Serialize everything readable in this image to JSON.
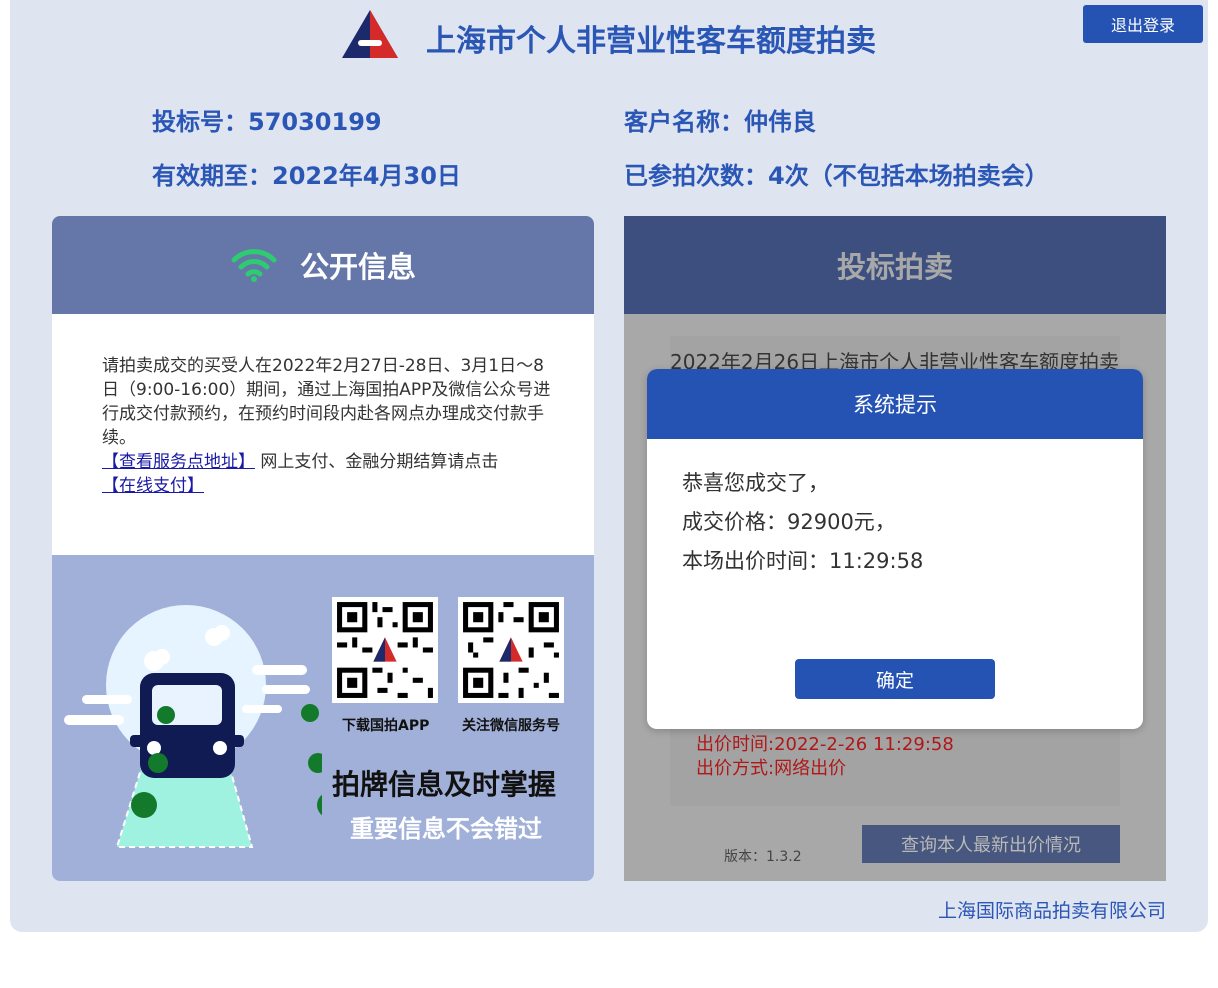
{
  "header": {
    "title": "上海市个人非营业性客车额度拍卖",
    "logout_label": "退出登录"
  },
  "bidder": {
    "bid_number": "投标号：57030199",
    "valid_until": "有效期至：2022年4月30日",
    "customer_name": "客户名称：仲伟良",
    "participation_count": "已参拍次数：4次（不包括本场拍卖会）"
  },
  "public_info": {
    "title": "公开信息",
    "notice": "请拍卖成交的买受人在2022年2月27日-28日、3月1日～8日（9:00-16:00）期间，通过上海国拍APP及微信公众号进行成交付款预约，在预约时间段内赴各网点办理成交付款手续。",
    "service_link": "【查看服务点地址】",
    "pay_text": "网上支付、金融分期结算请点击",
    "pay_link": "【在线支付】",
    "qr_app_caption": "下载国拍APP",
    "qr_wechat_caption": "关注微信服务号",
    "promo_main": "拍牌信息及时掌握",
    "promo_sub": "重要信息不会错过"
  },
  "bidding": {
    "title": "投标拍卖",
    "auction_heading": "2022年2月26日上海市个人非营业性客车额度拍卖",
    "bid_time": "出价时间:2022-2-26 11:29:58",
    "bid_method": "出价方式:网络出价",
    "version": "版本：1.3.2",
    "query_button": "查询本人最新出价情况"
  },
  "footer": {
    "company": "上海国际商品拍卖有限公司"
  },
  "modal": {
    "title": "系统提示",
    "line1": "恭喜您成交了，",
    "line2": "成交价格：92900元，",
    "line3": "本场出价时间：11:29:58",
    "ok_label": "确定"
  },
  "colors": {
    "brand_blue": "#2553b3",
    "panel_header": "#6577a8",
    "wifi_green": "#2ecc71"
  },
  "icons": [
    "logo-icon",
    "wifi-icon",
    "car-illustration",
    "qr-code-icon"
  ]
}
